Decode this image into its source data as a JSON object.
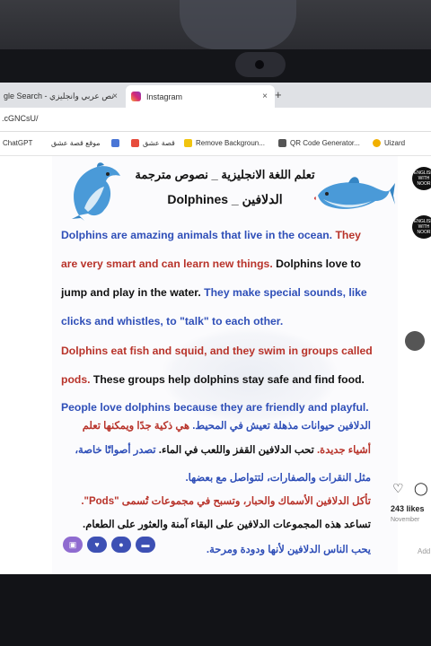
{
  "browser": {
    "tabs": [
      {
        "label": "gle Search - نص عربي وانجليزي"
      },
      {
        "label": "Instagram"
      }
    ],
    "new_tab": "+",
    "close": "×",
    "address": ".cGNCsU/",
    "bookmarks": [
      {
        "label": "ChatGPT",
        "color": "#10a37f"
      },
      {
        "label": "موقع قصة عشق",
        "color": "#c0392b"
      },
      {
        "label": "قصة عشق",
        "color": "#e74c3c"
      },
      {
        "label": "Remove Backgroun...",
        "color": "#444444"
      },
      {
        "label": "QR Code Generator...",
        "color": "#555555"
      },
      {
        "label": "Uizard",
        "color": "#f1b000"
      }
    ]
  },
  "post": {
    "title_ar": "تعلم اللغة الانجليزية _ نصوص مترجمة",
    "title_en": "Dolphines _ الدلافين",
    "en_lines": [
      [
        {
          "t": "Dolphins are amazing animals that live in the ocean. ",
          "c": "blue"
        },
        {
          "t": "They",
          "c": "red"
        }
      ],
      [
        {
          "t": "are very smart and can learn new things. ",
          "c": "red"
        },
        {
          "t": "Dolphins love to",
          "c": "black"
        }
      ],
      [
        {
          "t": "jump and play in the water. ",
          "c": "black"
        },
        {
          "t": "They make special sounds, like",
          "c": "blue"
        }
      ],
      [
        {
          "t": "clicks and whistles, to \"talk\" to each other.",
          "c": "blue"
        }
      ],
      [
        {
          "t": "Dolphins eat fish and squid, and they swim in groups called",
          "c": "red"
        }
      ],
      [
        {
          "t": "pods. ",
          "c": "red"
        },
        {
          "t": "These groups help dolphins stay safe and find food.",
          "c": "black"
        }
      ],
      [
        {
          "t": "People love dolphins because they are friendly and playful.",
          "c": "blue"
        }
      ]
    ],
    "ar_lines": [
      [
        {
          "t": "الدلافين حيوانات مذهلة تعيش في المحيط. ",
          "c": "blue"
        },
        {
          "t": "هي ذكية جدًا ويمكنها تعلم",
          "c": "red"
        }
      ],
      [
        {
          "t": "أشياء جديدة. ",
          "c": "red"
        },
        {
          "t": "تحب الدلافين القفز واللعب في الماء. ",
          "c": "black"
        },
        {
          "t": "تصدر أصواتًا خاصة،",
          "c": "blue"
        }
      ],
      [
        {
          "t": "مثل النقرات والصفارات، لتتواصل مع بعضها.",
          "c": "blue"
        }
      ],
      [
        {
          "t": "تأكل الدلافين الأسماك والحبار، وتسبح في مجموعات تُسمى \"Pods\".",
          "c": "red"
        }
      ],
      [
        {
          "t": "تساعد هذه المجموعات الدلافين على البقاء آمنة والعثور على الطعام.",
          "c": "black"
        }
      ],
      [
        {
          "t": "يحب الناس الدلافين لأنها ودودة ومرحة.",
          "c": "blue"
        }
      ]
    ],
    "colors": {
      "blue": "#2f4fb8",
      "red": "#b8332a",
      "black": "#111111"
    }
  },
  "sidebar": {
    "avatar_label": "ENGLISH WITH NOOR",
    "likes": "243 likes",
    "date": "November",
    "add_comment": "Add"
  }
}
